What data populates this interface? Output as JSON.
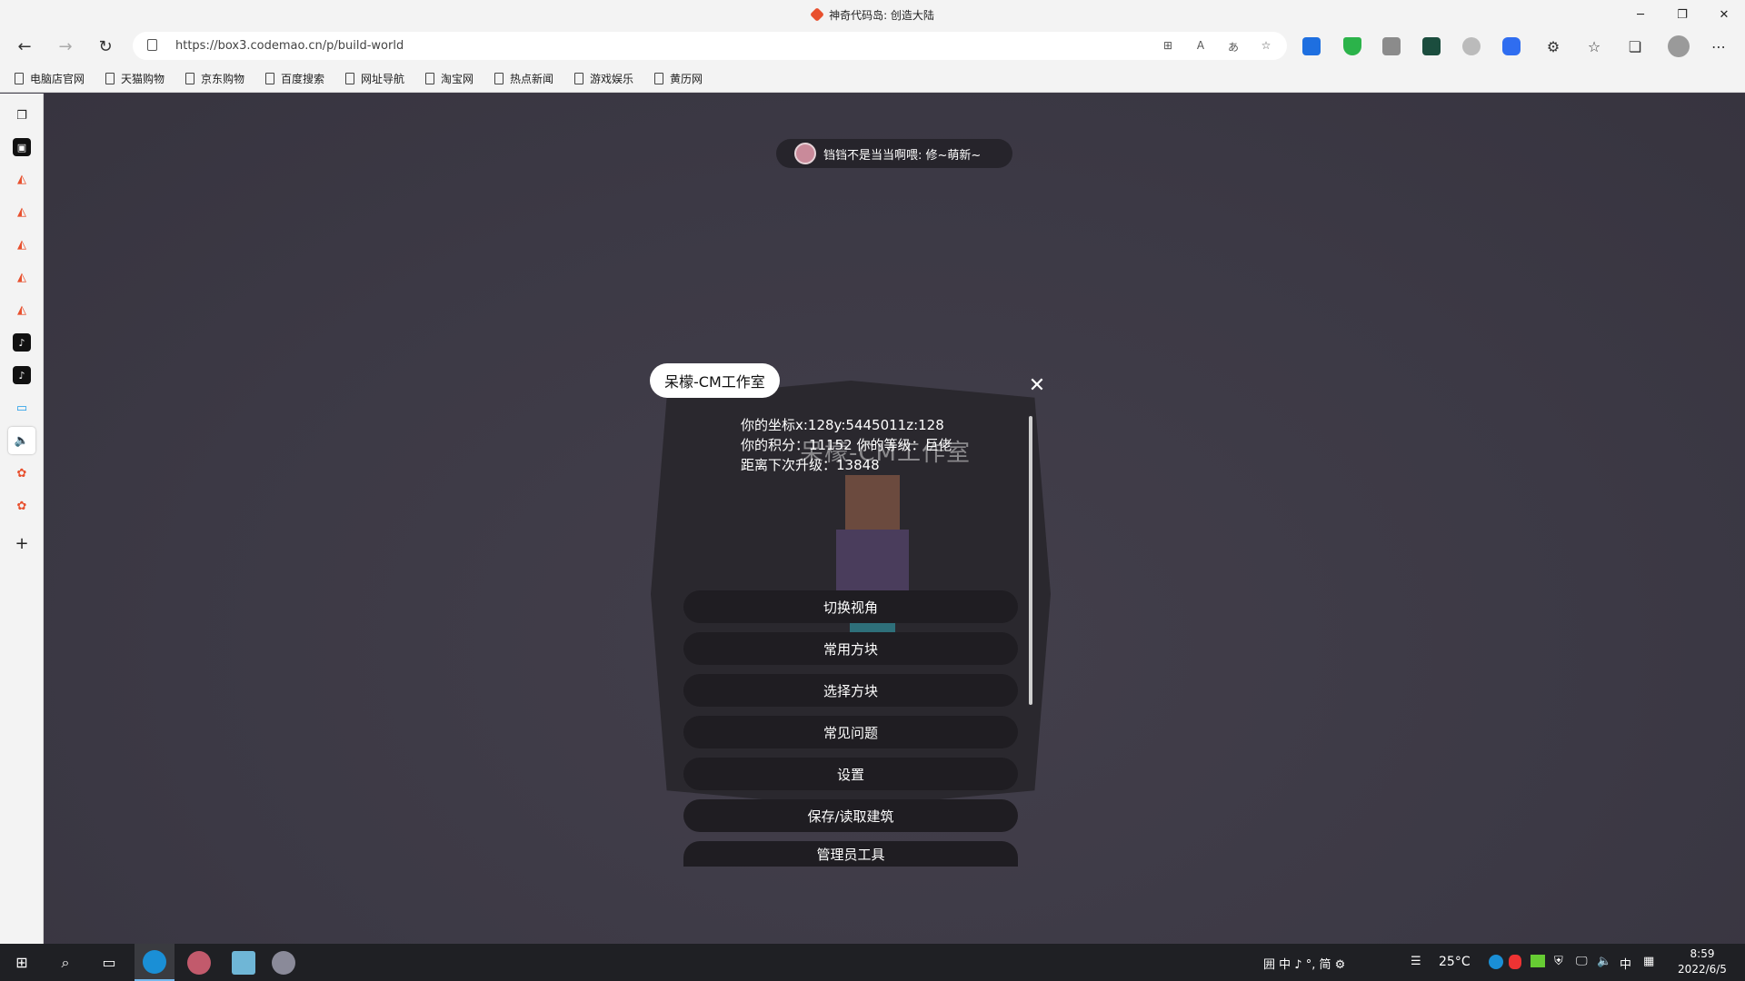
{
  "window": {
    "title": "神奇代码岛: 创造大陆",
    "controls": [
      "minimize",
      "restore",
      "close"
    ]
  },
  "address_bar": {
    "url": "https://box3.codemao.cn/p/build-world"
  },
  "favorites": [
    "电脑店官网",
    "天猫购物",
    "京东购物",
    "百度搜索",
    "网址导航",
    "淘宝网",
    "热点新闻",
    "游戏娱乐",
    "黄历网"
  ],
  "game": {
    "notice": "铛铛不是当当啊喂: 修~萌新~",
    "panel": {
      "title": "呆檬-CM工作室",
      "watermark": "呆檬-CM工作室",
      "info_line1": "你的坐标x:128y:5445011z:128",
      "info_line2": "你的积分：11152 你的等级：巨佬",
      "info_line3": "距离下次升级：13848",
      "buttons": [
        "切换视角",
        "常用方块",
        "选择方块",
        "常见问题",
        "设置",
        "保存/读取建筑",
        "管理员工具"
      ]
    }
  },
  "taskbar": {
    "tray": {
      "ime_indicators": "囲 中 ♪ °, 简 ⚙",
      "weather": "25°C",
      "lang": "中"
    },
    "clock": {
      "time": "8:59",
      "date": "2022/6/5"
    }
  },
  "colors": {
    "game_bg": "#3e3b47",
    "panel_bg": "#2a282e",
    "button_bg": "#1f1d22",
    "taskbar_bg": "#1f2024",
    "brand_orange": "#e8502e"
  }
}
